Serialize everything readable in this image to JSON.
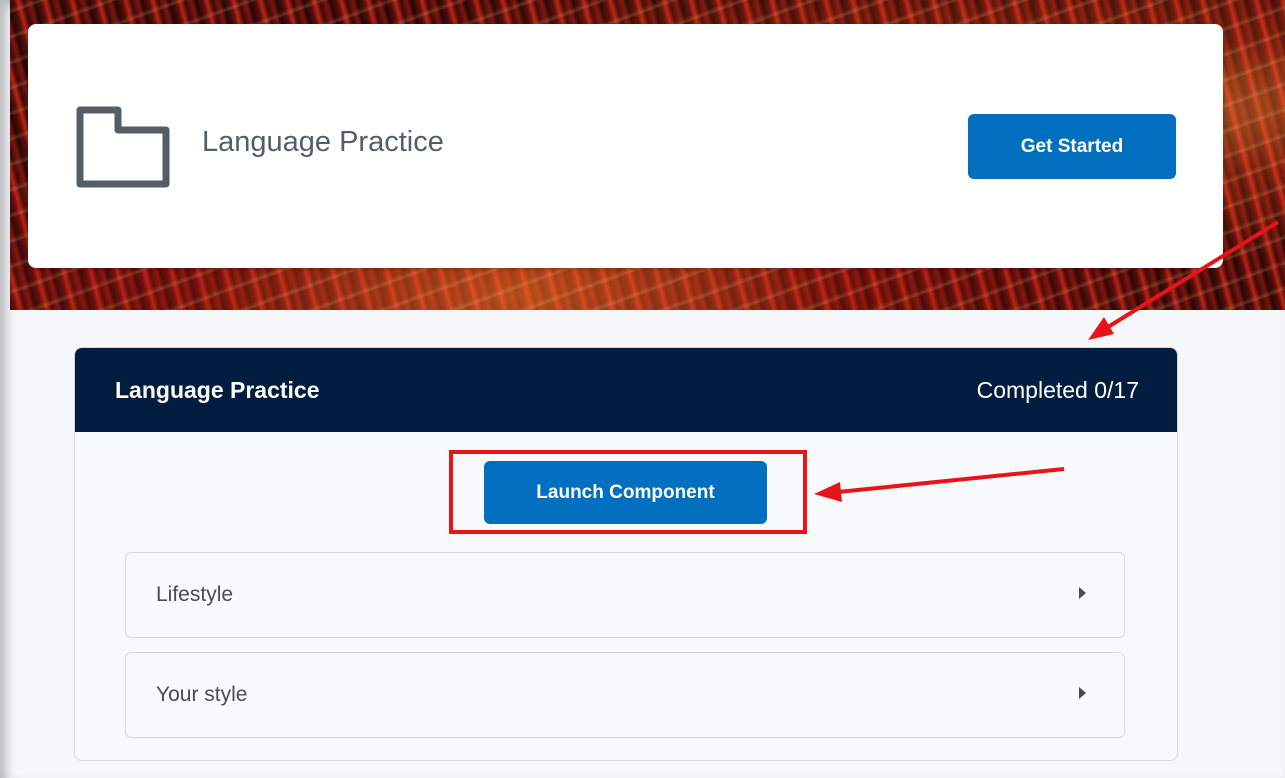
{
  "top_card": {
    "title": "Language Practice",
    "icon": "folder-icon",
    "get_started_label": "Get Started"
  },
  "module": {
    "title": "Language Practice",
    "status": "Completed 0/17",
    "launch_label": "Launch Component",
    "items": [
      {
        "label": "Lifestyle",
        "icon": "expand-arrow-icon"
      },
      {
        "label": "Your style",
        "icon": "expand-arrow-icon"
      }
    ]
  },
  "colors": {
    "primary_button": "#006fbf",
    "module_header": "#001c3f",
    "annotation_red": "#e8141b"
  }
}
